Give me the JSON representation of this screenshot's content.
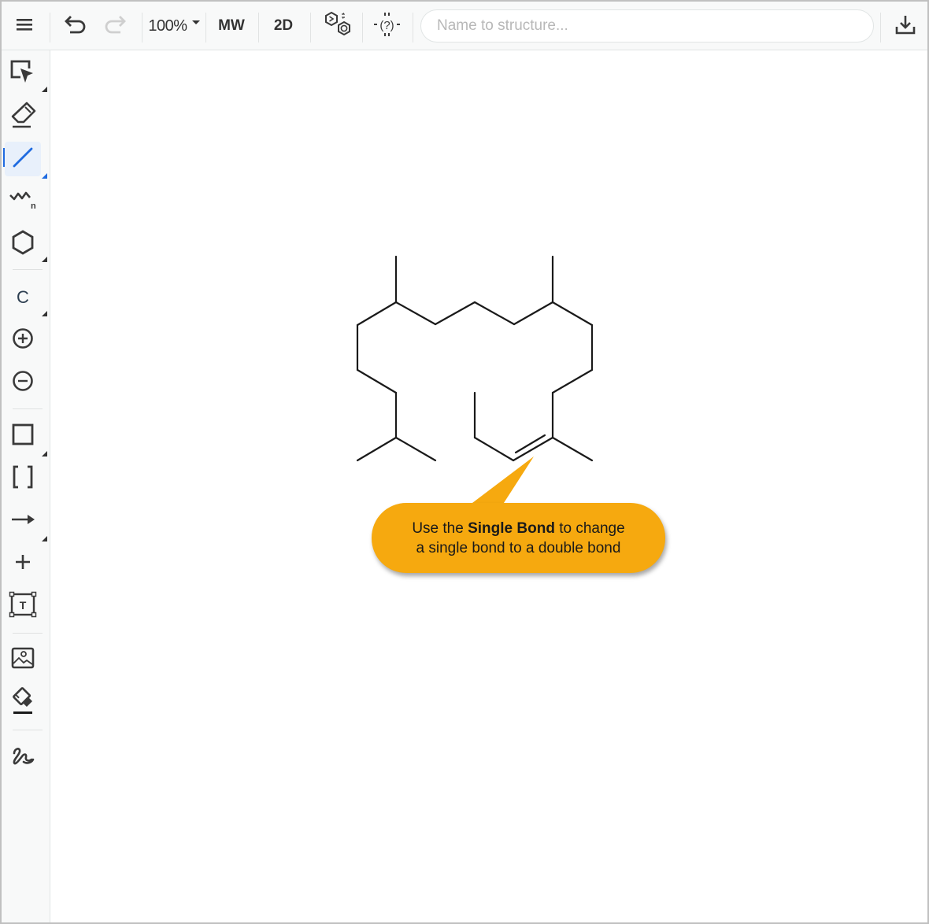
{
  "toolbar": {
    "menu_icon": "hamburger-menu-icon",
    "undo_icon": "undo-icon",
    "redo_icon": "redo-icon",
    "zoom_level": "100%",
    "mw_label": "MW",
    "clean_2d_label": "2D",
    "aromatize_icon": "aromatize-rings-icon",
    "check_structure_icon": "check-structure-icon",
    "name_input_placeholder": "Name to structure...",
    "name_input_value": "",
    "export_icon": "download-icon"
  },
  "left_toolbar": {
    "items": [
      {
        "name": "selection-tool",
        "icon": "select-arrow-icon",
        "active": false
      },
      {
        "name": "eraser-tool",
        "icon": "eraser-icon",
        "active": false
      },
      {
        "name": "single-bond-tool",
        "icon": "single-bond-icon",
        "active": true
      },
      {
        "name": "chain-tool",
        "icon": "chain-n-icon",
        "label": "n",
        "active": false
      },
      {
        "name": "ring-tool",
        "icon": "hexagon-icon",
        "active": false
      },
      {
        "name": "atom-tool",
        "icon": "atom-c-icon",
        "label": "C",
        "active": false
      },
      {
        "name": "positive-charge-tool",
        "icon": "plus-circle-icon",
        "active": false
      },
      {
        "name": "negative-charge-tool",
        "icon": "minus-circle-icon",
        "active": false
      },
      {
        "name": "shape-tool",
        "icon": "square-icon",
        "active": false
      },
      {
        "name": "bracket-tool",
        "icon": "brackets-icon",
        "label": "[ ]",
        "active": false
      },
      {
        "name": "arrow-tool",
        "icon": "arrow-right-icon",
        "active": false
      },
      {
        "name": "reaction-plus-tool",
        "icon": "plus-icon",
        "active": false
      },
      {
        "name": "text-tool",
        "icon": "text-box-icon",
        "label": "T",
        "active": false
      },
      {
        "name": "image-tool",
        "icon": "image-icon",
        "active": false
      },
      {
        "name": "fill-tool",
        "icon": "paint-bucket-icon",
        "active": false
      },
      {
        "name": "freehand-tool",
        "icon": "freehand-icon",
        "active": false
      }
    ]
  },
  "colors": {
    "accent": "#1f6be0",
    "tooltip_bg": "#f6a90f",
    "bond": "#1a1a1a"
  },
  "tooltip": {
    "prefix": "Use the ",
    "bold": "Single Bond",
    "suffix": " to change",
    "line2": "a single bond to a double bond"
  }
}
